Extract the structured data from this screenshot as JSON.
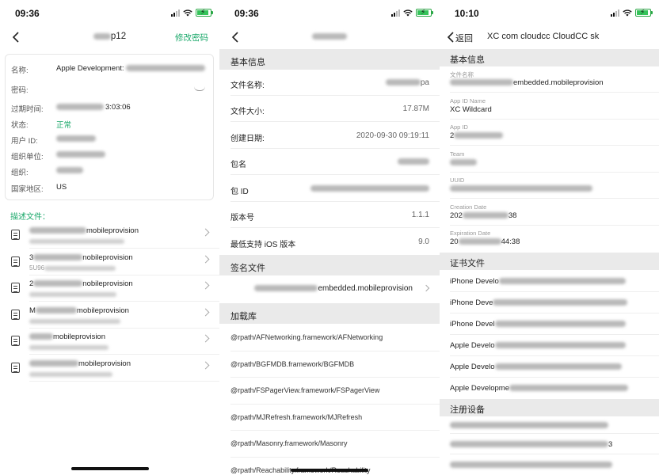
{
  "screen1": {
    "status_time": "09:36",
    "title": "p12",
    "action": "修改密码",
    "fields": [
      {
        "label": "名称:",
        "value": "Apple Development:"
      },
      {
        "label": "密码:",
        "value": ""
      },
      {
        "label": "过期时间:",
        "value": "2 3:03:06"
      },
      {
        "label": "状态:",
        "value": "正常"
      },
      {
        "label": "用户 ID:",
        "value": ""
      },
      {
        "label": "组织单位:",
        "value": ""
      },
      {
        "label": "组织:",
        "value": ""
      },
      {
        "label": "国家地区:",
        "value": "US"
      }
    ],
    "section_label": "描述文件：",
    "profiles": [
      {
        "name": "mobileprovision",
        "sub": "5"
      },
      {
        "name": "3 nobileprovision",
        "sub": "5U96"
      },
      {
        "name": "2 nobileprovision",
        "sub": ""
      },
      {
        "name": "M mobileprovision",
        "sub": ""
      },
      {
        "name": "mobileprovision",
        "sub": ""
      },
      {
        "name": "mobileprovision",
        "sub": ""
      }
    ]
  },
  "screen2": {
    "status_time": "09:36",
    "title": "",
    "section_basic": "基本信息",
    "rows": [
      {
        "label": "文件名称:",
        "value": "pa"
      },
      {
        "label": "文件大小:",
        "value": "17.87M"
      },
      {
        "label": "创建日期:",
        "value": "2020-09-30 09:19:11"
      },
      {
        "label": "包名",
        "value": ""
      },
      {
        "label": "包 ID",
        "value": ""
      },
      {
        "label": "版本号",
        "value": "1.1.1"
      },
      {
        "label": "最低支持 iOS 版本",
        "value": "9.0"
      }
    ],
    "section_sign": "签名文件",
    "sign_file": "embedded.mobileprovision",
    "section_libs": "加载库",
    "libs": [
      "@rpath/AFNetworking.framework/AFNetworking",
      "@rpath/BGFMDB.framework/BGFMDB",
      "@rpath/FSPagerView.framework/FSPagerView",
      "@rpath/MJRefresh.framework/MJRefresh",
      "@rpath/Masonry.framework/Masonry",
      "@rpath/Reachability.framework/Reachability"
    ]
  },
  "screen3": {
    "status_time": "10:10",
    "back_label": "返回",
    "title": "XC com cloudcc CloudCC sk",
    "section_basic": "基本信息",
    "items": [
      {
        "label": "文件名称",
        "value": "embedded.mobileprovision"
      },
      {
        "label": "App ID Name",
        "value": "XC Wildcard"
      },
      {
        "label": "App ID",
        "value": "2"
      },
      {
        "label": "Team",
        "value": ""
      },
      {
        "label": "UUID",
        "value": ""
      },
      {
        "label": "Creation Date",
        "value": "202 38"
      },
      {
        "label": "Expiration Date",
        "value": "20 44:38"
      }
    ],
    "section_certs": "证书文件",
    "certs": [
      "iPhone Develo",
      "iPhone Deve",
      "iPhone Devel",
      "Apple Develo",
      "Apple Develo",
      "Apple Developme"
    ],
    "section_devices": "注册设备",
    "devices": [
      "",
      "3",
      ""
    ]
  }
}
